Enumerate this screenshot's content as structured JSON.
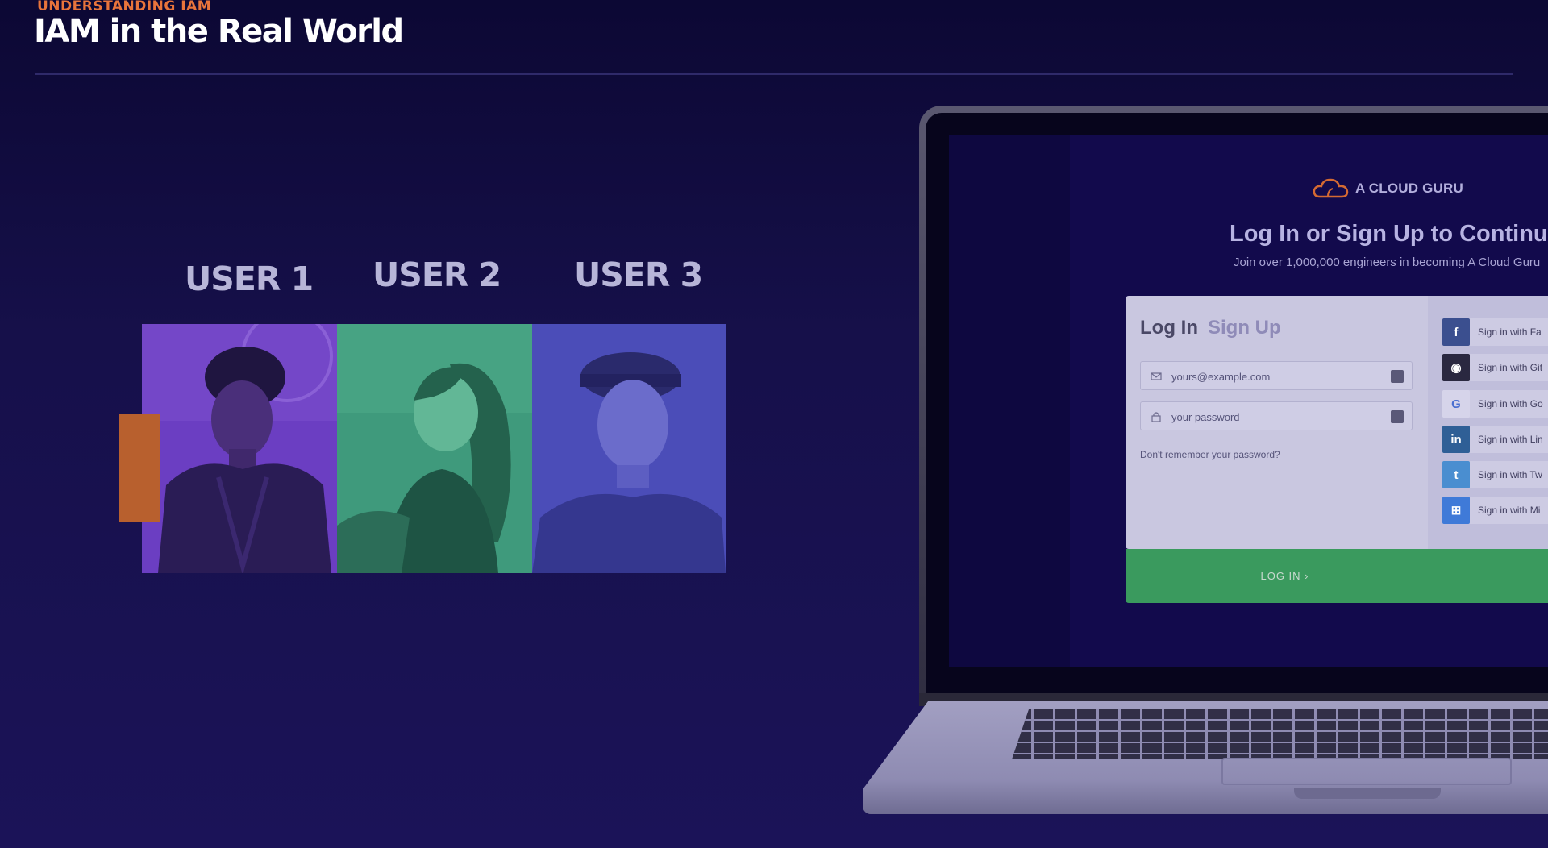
{
  "header": {
    "eyebrow": "UNDERSTANDING IAM",
    "title": "IAM in the Real World"
  },
  "users": [
    {
      "label": "USER 1",
      "tint": "#6a3fc0"
    },
    {
      "label": "USER 2",
      "tint": "#3f9a7c"
    },
    {
      "label": "USER 3",
      "tint": "#4b4db8"
    }
  ],
  "colors": {
    "accent": "#e8743b",
    "background": "#16104a",
    "login_button": "#3a9a5e"
  },
  "login_screen": {
    "brand": "A CLOUD GURU",
    "heading": "Log In or Sign Up to Continue",
    "subheading": "Join over 1,000,000 engineers in becoming A Cloud Guru",
    "tab_login": "Log In",
    "tab_signup": "Sign Up",
    "email_placeholder": "yours@example.com",
    "password_placeholder": "your password",
    "forgot": "Don't remember your password?",
    "login_button": "LOG IN ›",
    "social": [
      {
        "icon": "facebook-icon",
        "glyph": "f",
        "label": "Sign in with Fa",
        "color": "#3b4f8f"
      },
      {
        "icon": "github-icon",
        "glyph": "◉",
        "label": "Sign in with Git",
        "color": "#2a2840"
      },
      {
        "icon": "google-icon",
        "glyph": "G",
        "label": "Sign in with Go",
        "color": "#cdcbe3"
      },
      {
        "icon": "linkedin-icon",
        "glyph": "in",
        "label": "Sign in with Lin",
        "color": "#2f5f96"
      },
      {
        "icon": "twitter-icon",
        "glyph": "t",
        "label": "Sign in with Tw",
        "color": "#4a8ed0"
      },
      {
        "icon": "microsoft-icon",
        "glyph": "⊞",
        "label": "Sign in with Mi",
        "color": "#3f7ad8"
      }
    ]
  }
}
